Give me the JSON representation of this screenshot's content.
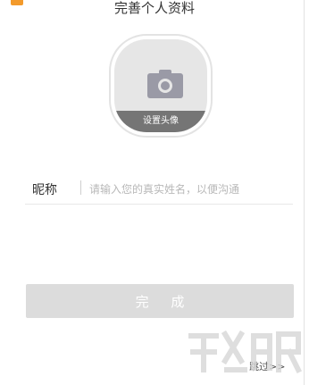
{
  "window": {
    "title": "完善个人资料"
  },
  "avatar": {
    "caption": "设置头像",
    "icon": "camera-icon"
  },
  "nickname": {
    "label": "昵称",
    "placeholder": "请输入您的真实姓名，以便沟通",
    "value": ""
  },
  "actions": {
    "done_label": "完 成",
    "skip_label": "跳过>>"
  },
  "colors": {
    "button_disabled": "#dcdcdc",
    "avatar_bg": "#e6e6e6",
    "caption_bg": "#757575",
    "logo_accent": "#f39a2b"
  }
}
